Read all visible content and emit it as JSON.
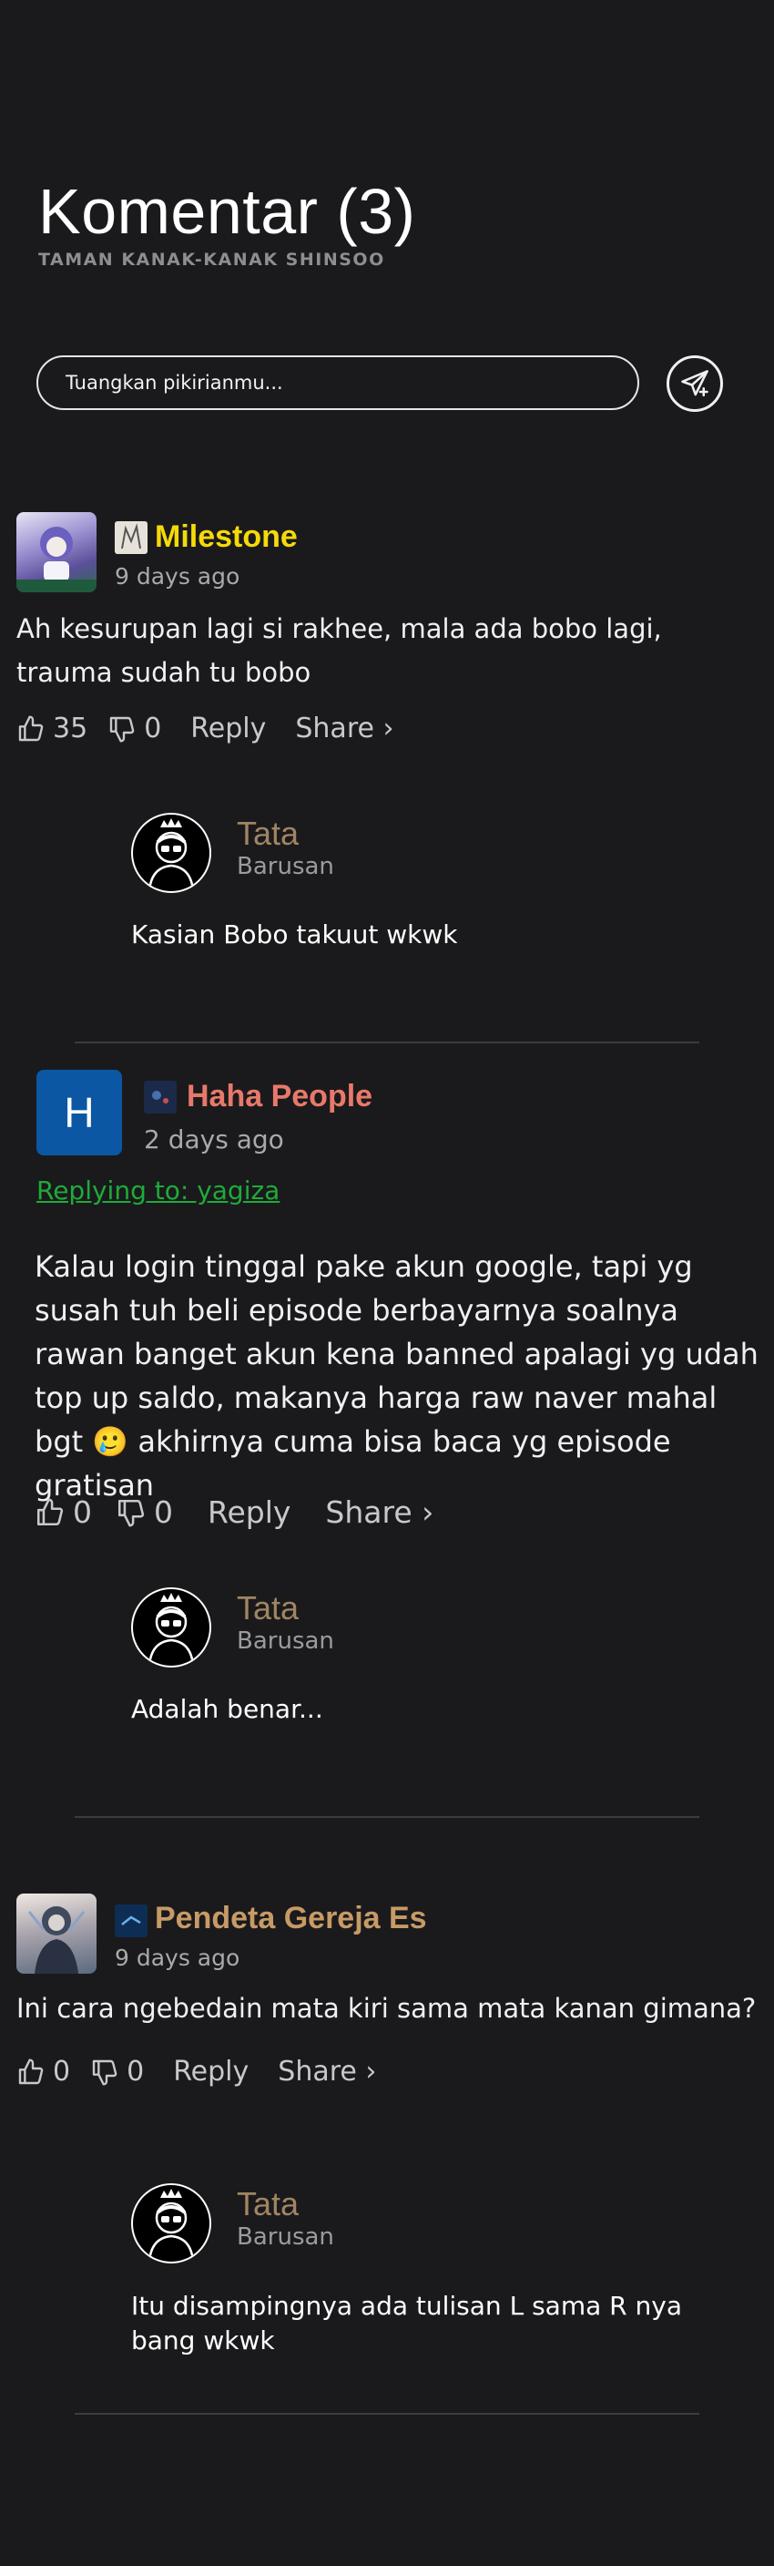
{
  "header": {
    "title": "Komentar (3)",
    "subtitle": "TAMAN KANAK-KANAK SHINSOO"
  },
  "composer": {
    "placeholder": "Tuangkan pikirianmu..."
  },
  "comments": [
    {
      "username": "Milestone",
      "name_color": "#f5d90a",
      "time": "9 days ago",
      "text": "Ah kesurupan lagi si rakhee, mala ada bobo lagi, trauma sudah tu bobo",
      "likes": "35",
      "dislikes": "0",
      "reply_label": "Reply",
      "share_label": "Share ›",
      "reply": {
        "name": "Tata",
        "time": "Barusan",
        "text": "Kasian Bobo takuut wkwk"
      }
    },
    {
      "username": "Haha People",
      "name_color": "#e8796a",
      "avatar_letter": "H",
      "time": "2 days ago",
      "replying_to": "Replying to: yagiza",
      "text": "Kalau login tinggal pake akun google, tapi yg susah tuh beli episode berbayarnya soalnya rawan banget akun kena banned apalagi yg udah top up saldo, makanya harga raw naver mahal bgt 🥲 akhirnya cuma bisa baca yg episode gratisan",
      "likes": "0",
      "dislikes": "0",
      "reply_label": "Reply",
      "share_label": "Share ›",
      "reply": {
        "name": "Tata",
        "time": "Barusan",
        "text": "Adalah benar..."
      }
    },
    {
      "username": "Pendeta Gereja Es",
      "name_color": "#c79a66",
      "time": "9 days ago",
      "text": "Ini cara ngebedain mata kiri sama mata kanan gimana?",
      "likes": "0",
      "dislikes": "0",
      "reply_label": "Reply",
      "share_label": "Share ›",
      "reply": {
        "name": "Tata",
        "time": "Barusan",
        "text": "Itu disampingnya ada tulisan L sama R nya bang wkwk"
      }
    }
  ]
}
